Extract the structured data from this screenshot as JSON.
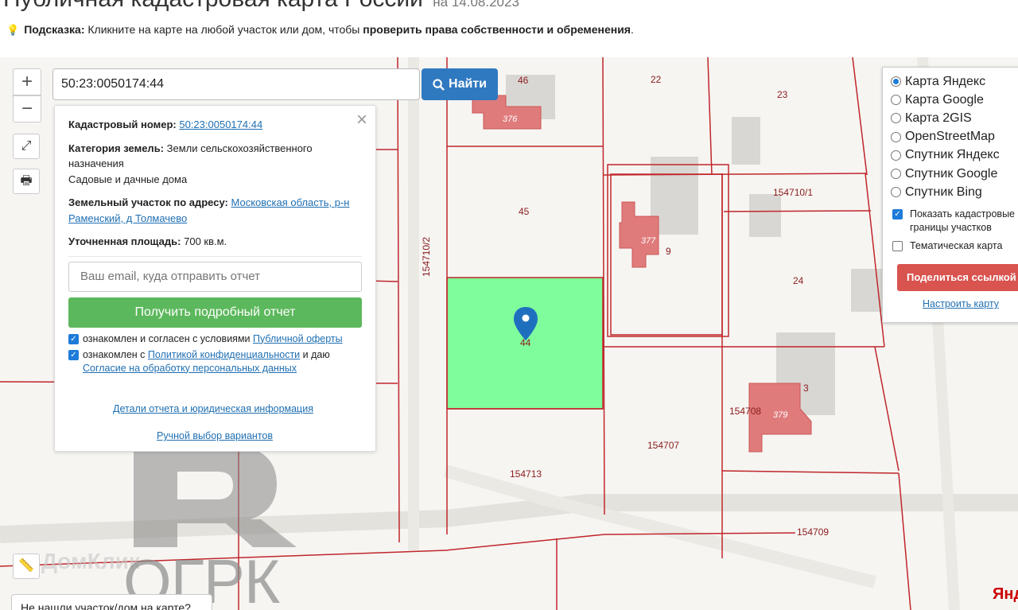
{
  "header": {
    "title": "Публичная кадастровая карта России",
    "date": "на 14.08.2023",
    "hint_label": "Подсказка:",
    "hint_text": " Кликните на карте на любой участок или дом, чтобы ",
    "hint_bold": "проверить права собственности и обременения",
    "hint_end": "."
  },
  "search": {
    "value": "50:23:0050174:44",
    "button_label": "Найти"
  },
  "info": {
    "cadastral_label": "Кадастровый номер:",
    "cadastral_value": "50:23:0050174:44",
    "category_label": "Категория земель:",
    "category_value": "Земли сельскохозяйственного назначения",
    "usage_value": "Садовые и дачные дома",
    "address_label": "Земельный участок по адресу:",
    "address_value": "Московская область, р-н Раменский, д Толмачево",
    "area_label": "Уточненная площадь:",
    "area_value": "700 кв.м.",
    "email_placeholder": "Ваш email, куда отправить отчет",
    "report_button": "Получить подробный отчет",
    "agree1_text": "ознакомлен и согласен с условиями ",
    "agree1_link": "Публичной оферты",
    "agree2_text": "ознакомлен с ",
    "agree2_link": "Политикой конфиденциальности",
    "agree2_mid": " и даю",
    "agree2_link2": "Согласие на обработку персональных данных",
    "details_link": "Детали отчета и юридическая информация",
    "manual_link": "Ручной выбор вариантов"
  },
  "layers": {
    "items": [
      "Карта Яндекс",
      "Карта Google",
      "Карта 2GIS",
      "OpenStreetMap",
      "Спутник Яндекс",
      "Спутник Google",
      "Спутник Bing"
    ],
    "selected_index": 0,
    "show_borders": "Показать кадастровые границы участков",
    "show_borders_checked": true,
    "thematic": "Тематическая карта",
    "thematic_checked": false,
    "share_button": "Поделиться ссылкой",
    "setup_link": "Настроить карту"
  },
  "map": {
    "plots": [
      "46",
      "22",
      "23",
      "45",
      "154710/1",
      "154710/2",
      "24",
      "44",
      "9",
      "3",
      "154708",
      "154707",
      "154713",
      "154709"
    ],
    "buildings": [
      "376",
      "377",
      "379"
    ],
    "selected_plot_color": "#7ffc9c",
    "border_color": "#c0262b"
  },
  "footer": {
    "not_found": "Не нашли участок/дом на карте?",
    "attribution": "Янд",
    "watermark_text": "ОГРК",
    "watermark_small": "ДомКлик"
  },
  "colors": {
    "accent_blue": "#2f79c0",
    "report_green": "#5cb85c",
    "share_red": "#d9534f"
  }
}
